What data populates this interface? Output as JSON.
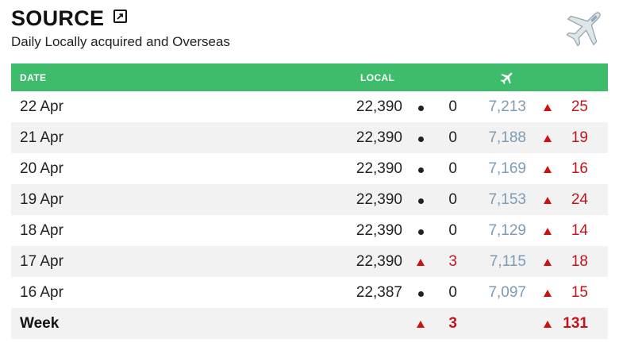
{
  "header": {
    "title": "SOURCE",
    "subtitle": "Daily Locally acquired and Overseas",
    "expand_icon": "expand-icon",
    "plane_icon": "airplane-icon"
  },
  "table": {
    "columns": {
      "date": "DATE",
      "local": "LOCAL",
      "overseas_icon": "airplane-icon"
    },
    "rows": [
      {
        "date": "22 Apr",
        "local": "22,390",
        "local_indicator": "dot",
        "local_change": "0",
        "overseas": "7,213",
        "overseas_indicator": "up",
        "overseas_change": "25"
      },
      {
        "date": "21 Apr",
        "local": "22,390",
        "local_indicator": "dot",
        "local_change": "0",
        "overseas": "7,188",
        "overseas_indicator": "up",
        "overseas_change": "19"
      },
      {
        "date": "20 Apr",
        "local": "22,390",
        "local_indicator": "dot",
        "local_change": "0",
        "overseas": "7,169",
        "overseas_indicator": "up",
        "overseas_change": "16"
      },
      {
        "date": "19 Apr",
        "local": "22,390",
        "local_indicator": "dot",
        "local_change": "0",
        "overseas": "7,153",
        "overseas_indicator": "up",
        "overseas_change": "24"
      },
      {
        "date": "18 Apr",
        "local": "22,390",
        "local_indicator": "dot",
        "local_change": "0",
        "overseas": "7,129",
        "overseas_indicator": "up",
        "overseas_change": "14"
      },
      {
        "date": "17 Apr",
        "local": "22,390",
        "local_indicator": "up",
        "local_change": "3",
        "overseas": "7,115",
        "overseas_indicator": "up",
        "overseas_change": "18"
      },
      {
        "date": "16 Apr",
        "local": "22,387",
        "local_indicator": "dot",
        "local_change": "0",
        "overseas": "7,097",
        "overseas_indicator": "up",
        "overseas_change": "15"
      }
    ],
    "week": {
      "label": "Week",
      "local_indicator": "up",
      "local_change": "3",
      "overseas_indicator": "up",
      "overseas_change": "131"
    }
  },
  "colors": {
    "header_green": "#3dbd6b",
    "increase_red": "#c4141b",
    "overseas_blue_grey": "#7d9bb4",
    "alt_row": "#f2f2f2"
  }
}
